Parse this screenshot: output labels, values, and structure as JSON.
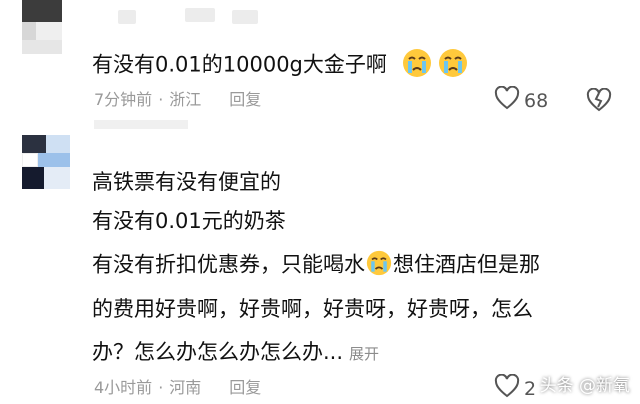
{
  "comments": [
    {
      "text": "有没有0.01的10000g大金子啊",
      "time": "7分钟前",
      "location": "浙江",
      "reply_label": "回复",
      "like_count": "68"
    },
    {
      "lines": [
        "高铁票有没有便宜的",
        "有没有0.01元的奶茶",
        "有没有折扣优惠券，只能喝水",
        "想住酒店但是那",
        "的费用好贵啊，好贵啊，好贵呀，好贵呀，怎么",
        "办？怎么办怎么办怎么办..."
      ],
      "expand_label": "展开",
      "time": "4小时前",
      "location": "河南",
      "reply_label": "回复",
      "like_count": "2"
    }
  ],
  "watermark": "头条 @新氧",
  "icons": [
    "crying-emoji-icon",
    "heart-icon",
    "dislike-icon",
    "avatar"
  ]
}
